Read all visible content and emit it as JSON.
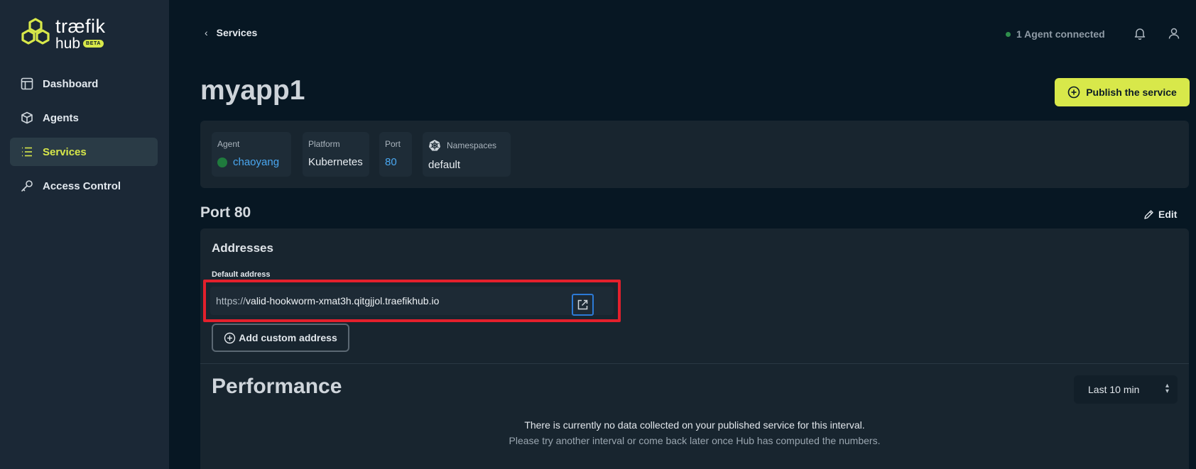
{
  "brand": {
    "name": "træfik",
    "sub": "hub",
    "badge": "BETA",
    "accent": "#d8e84a"
  },
  "sidebar": {
    "items": [
      {
        "label": "Dashboard",
        "icon": "layout-icon"
      },
      {
        "label": "Agents",
        "icon": "cube-icon"
      },
      {
        "label": "Services",
        "icon": "list-icon",
        "active": true
      },
      {
        "label": "Access Control",
        "icon": "key-icon"
      }
    ]
  },
  "topbar": {
    "back_label": "Services",
    "agent_status": "1 Agent connected"
  },
  "page": {
    "title": "myapp1",
    "publish_label": "Publish the service"
  },
  "info": {
    "agent_key": "Agent",
    "agent_value": "chaoyang",
    "platform_key": "Platform",
    "platform_value": "Kubernetes",
    "port_key": "Port",
    "port_value": "80",
    "namespaces_key": "Namespaces",
    "namespaces_value": "default"
  },
  "port_section": {
    "title": "Port 80",
    "edit_label": "Edit",
    "addresses_title": "Addresses",
    "default_address_label": "Default address",
    "address_prefix": "https://",
    "address_host": "valid-hookworm-xmat3h.qitgjjol.traefikhub.io",
    "add_custom_label": "Add custom address"
  },
  "performance": {
    "title": "Performance",
    "interval": "Last 10 min",
    "empty_line1": "There is currently no data collected on your published service for this interval.",
    "empty_line2": "Please try another interval or come back later once Hub has computed the numbers."
  }
}
